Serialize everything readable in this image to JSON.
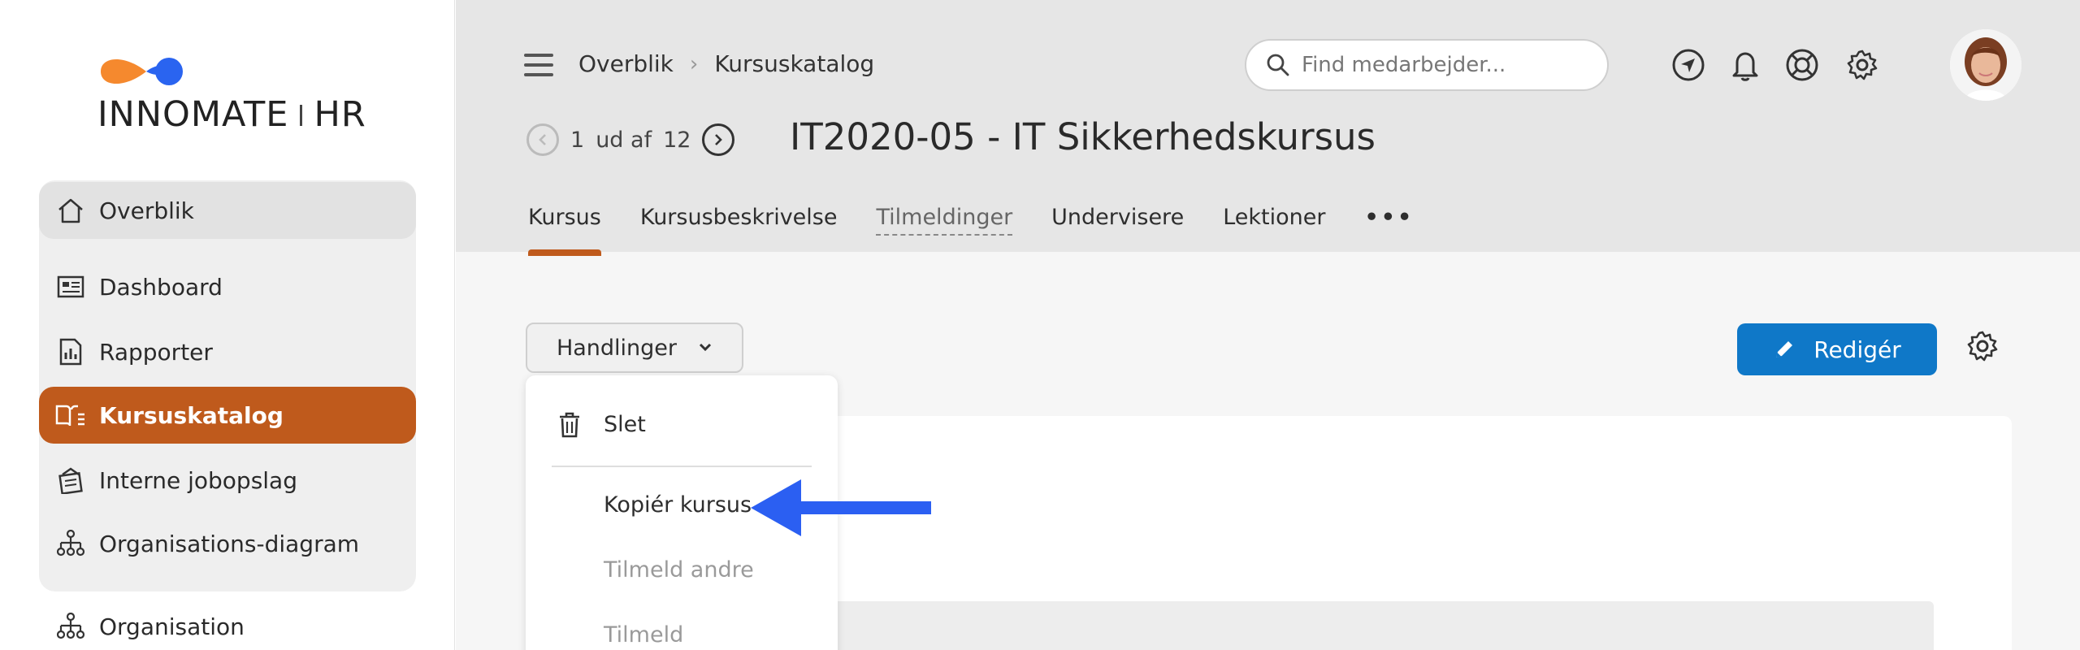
{
  "brand": {
    "left": "INNOMATE",
    "right": "HR"
  },
  "sidebar": {
    "items": [
      {
        "label": "Overblik"
      },
      {
        "label": "Dashboard"
      },
      {
        "label": "Rapporter"
      },
      {
        "label": "Kursuskatalog"
      },
      {
        "label": "Interne jobopslag"
      },
      {
        "label": "Organisations-diagram"
      },
      {
        "label": "Organisation"
      }
    ]
  },
  "header": {
    "breadcrumb": [
      "Overblik",
      "Kursuskatalog"
    ],
    "search_placeholder": "Find medarbejder...",
    "pager": {
      "current": "1",
      "of_label": "ud af",
      "total": "12"
    },
    "title": "IT2020-05 - IT Sikkerhedskursus"
  },
  "tabs": [
    {
      "label": "Kursus"
    },
    {
      "label": "Kursusbeskrivelse"
    },
    {
      "label": "Tilmeldinger"
    },
    {
      "label": "Undervisere"
    },
    {
      "label": "Lektioner"
    },
    {
      "label": "•••"
    }
  ],
  "toolbar": {
    "actions_label": "Handlinger",
    "edit_label": "Redigér"
  },
  "dropdown": {
    "items": [
      {
        "label": "Slet"
      },
      {
        "label": "Kopiér kursus"
      },
      {
        "label": "Tilmeld andre"
      },
      {
        "label": "Tilmeld"
      }
    ]
  },
  "colors": {
    "accent": "#bf5a1c",
    "primary": "#0f78c8",
    "arrow": "#2b5ff2",
    "logo_orange": "#f5892e",
    "logo_blue": "#2a64f0"
  }
}
